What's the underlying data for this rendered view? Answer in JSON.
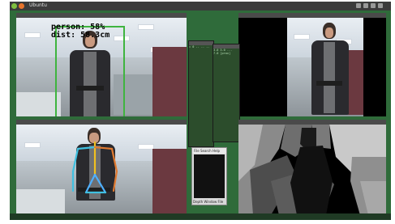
{
  "topbar": {
    "app_label": "Ubuntu",
    "dot_colors": [
      "#7fbf3f",
      "#e8742c"
    ]
  },
  "detection": {
    "class_label": "person: 58%",
    "distance_label": "dist: 58.3cm",
    "bbox_color": "#3fb43f"
  },
  "windows": {
    "detector_window": "object-detection-view",
    "rgb_window": "rgb-camera-view",
    "skeleton_window": "pose-estimation-view",
    "depth_window": "depth-map-view"
  },
  "terminal": {
    "lines": [
      "= 0  -- -- --",
      "3.0 3.0 ...",
      "7.0 [prox]"
    ]
  },
  "small_window": {
    "menu": "File  Search  Help",
    "footer": "Depth  Window  File"
  },
  "skeleton_colors": {
    "spine": "#f0c020",
    "left_arm": "#40c0e0",
    "right_arm": "#e07a30",
    "legs": "#4fb0ff"
  }
}
